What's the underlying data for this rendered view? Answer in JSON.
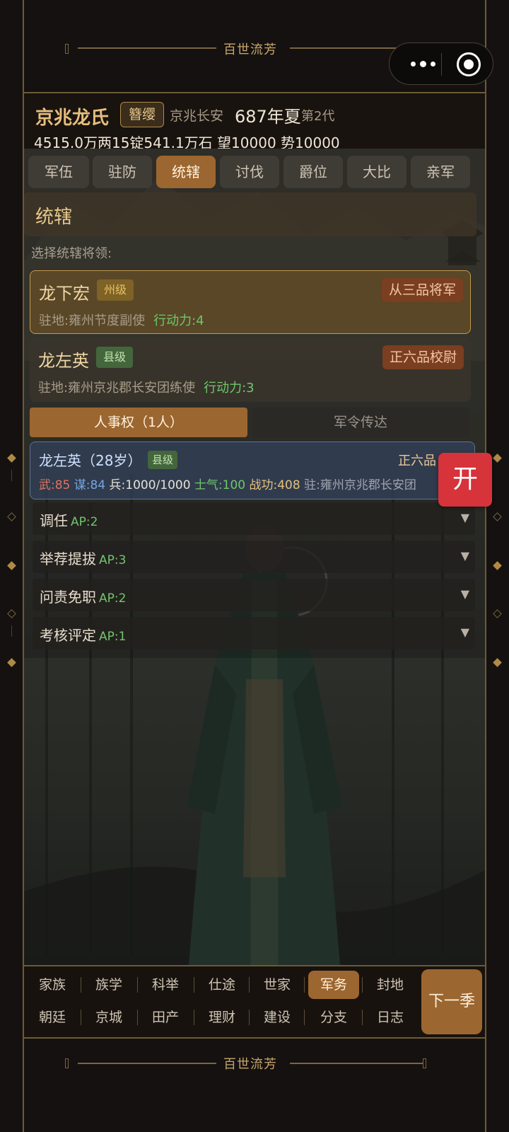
{
  "banner": {
    "title": "百世流芳"
  },
  "clan": {
    "name": "京兆龙氏",
    "badge": "簪缨",
    "place": "京兆长安",
    "year": "687年夏",
    "generation": "第2代",
    "wealth": "4515.0万两15锭541.1万石  望10000  势10000"
  },
  "tabs": [
    {
      "label": "军伍"
    },
    {
      "label": "驻防"
    },
    {
      "label": "统辖",
      "active": true
    },
    {
      "label": "讨伐"
    },
    {
      "label": "爵位"
    },
    {
      "label": "大比"
    },
    {
      "label": "亲军"
    }
  ],
  "section": {
    "title": "统辖"
  },
  "prompt": "选择统辖将领:",
  "generals": [
    {
      "name": "龙下宏",
      "level": "州级",
      "rank": "从三品将军",
      "station": "驻地:雍州节度副使",
      "ap": "行动力:4",
      "selected": true
    },
    {
      "name": "龙左英",
      "level": "县级",
      "rank": "正六品校尉",
      "station": "驻地:雍州京兆郡长安团练使",
      "ap": "行动力:3",
      "selected": false
    }
  ],
  "subtabs": [
    {
      "label": "人事权（1人）",
      "active": true
    },
    {
      "label": "军令传达",
      "active": false
    }
  ],
  "detail": {
    "name": "龙左英（28岁）",
    "level": "县级",
    "rank": "正六品",
    "wu": "武:85",
    "mou": "谋:84",
    "bing": "兵:1000/1000",
    "morale": "士气:100",
    "merit": "战功:408",
    "station": "驻:雍州京兆郡长安团"
  },
  "actions": [
    {
      "label": "调任",
      "ap": "AP:2"
    },
    {
      "label": "举荐提拔",
      "ap": "AP:3"
    },
    {
      "label": "问责免职",
      "ap": "AP:2"
    },
    {
      "label": "考核评定",
      "ap": "AP:1"
    }
  ],
  "open_button": "开",
  "nav": {
    "row1": [
      "家族",
      "族学",
      "科举",
      "仕途",
      "世家",
      "军务",
      "封地"
    ],
    "row2": [
      "朝廷",
      "京城",
      "田产",
      "理财",
      "建设",
      "分支",
      "日志"
    ],
    "active": "军务",
    "next_label": "下一季"
  }
}
